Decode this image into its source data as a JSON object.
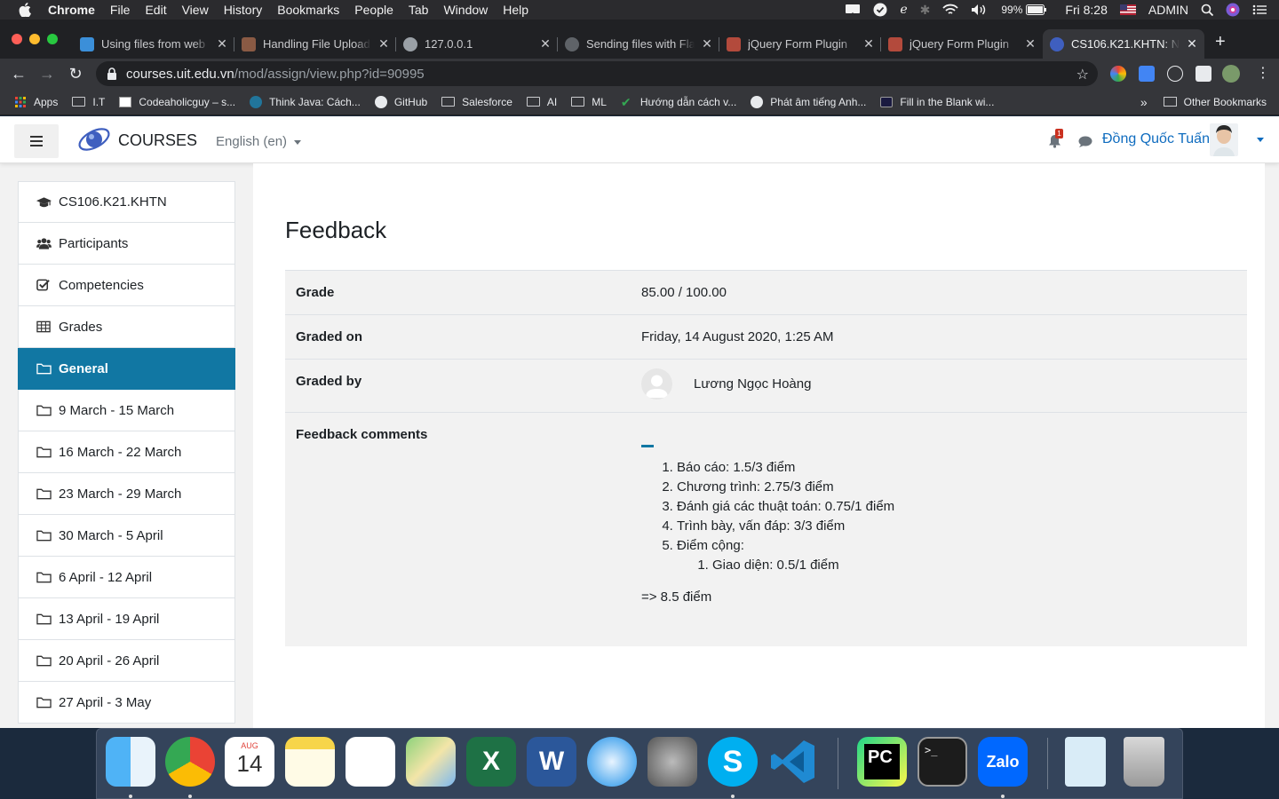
{
  "menubar": {
    "app": "Chrome",
    "items": [
      "File",
      "Edit",
      "View",
      "History",
      "Bookmarks",
      "People",
      "Tab",
      "Window",
      "Help"
    ],
    "battery": "99%",
    "clock": "Fri 8:28",
    "user": "ADMIN"
  },
  "tabs": [
    {
      "title": "Using files from web",
      "favicon_color": "#3b8fd9"
    },
    {
      "title": "Handling File Upload",
      "favicon_color": "#8a5a44"
    },
    {
      "title": "127.0.0.1",
      "favicon_color": "#9aa0a6"
    },
    {
      "title": "Sending files with Fla",
      "favicon_color": "#5f6368"
    },
    {
      "title": "jQuery Form Plugin",
      "favicon_color": "#b34a3c"
    },
    {
      "title": "jQuery Form Plugin",
      "favicon_color": "#b34a3c"
    },
    {
      "title": "CS106.K21.KHTN: N",
      "favicon_color": "#3f5fbf"
    }
  ],
  "toolbar": {
    "url_host": "courses.uit.edu.vn",
    "url_path": "/mod/assign/view.php?id=90995"
  },
  "bookmarks": {
    "items": [
      {
        "label": "Apps",
        "icon": "apps-grid-icon"
      },
      {
        "label": "I.T",
        "icon": "folder-icon"
      },
      {
        "label": "Codeaholicguy – s...",
        "icon": "site-icon"
      },
      {
        "label": "Think Java: Cách...",
        "icon": "wordpress-icon"
      },
      {
        "label": "GitHub",
        "icon": "github-icon"
      },
      {
        "label": "Salesforce",
        "icon": "folder-icon"
      },
      {
        "label": "AI",
        "icon": "folder-icon"
      },
      {
        "label": "ML",
        "icon": "folder-icon"
      },
      {
        "label": "Hướng dẫn cách v...",
        "icon": "check-icon"
      },
      {
        "label": "Phát âm tiếng Anh...",
        "icon": "globe-icon"
      },
      {
        "label": "Fill in the Blank wi...",
        "icon": "site-icon"
      }
    ],
    "overflow": "»",
    "other": "Other Bookmarks"
  },
  "navbar": {
    "brand": "COURSES",
    "language": "English (en)",
    "notification_count": "1",
    "user_name": "Đồng Quốc Tuấn"
  },
  "sidebar": {
    "items": [
      {
        "label": "CS106.K21.KHTN",
        "icon": "graduation-cap-icon",
        "active": false
      },
      {
        "label": "Participants",
        "icon": "users-icon",
        "active": false
      },
      {
        "label": "Competencies",
        "icon": "check-square-icon",
        "active": false
      },
      {
        "label": "Grades",
        "icon": "table-icon",
        "active": false
      },
      {
        "label": "General",
        "icon": "folder-icon",
        "active": true
      },
      {
        "label": "9 March - 15 March",
        "icon": "folder-icon",
        "active": false
      },
      {
        "label": "16 March - 22 March",
        "icon": "folder-icon",
        "active": false
      },
      {
        "label": "23 March - 29 March",
        "icon": "folder-icon",
        "active": false
      },
      {
        "label": "30 March - 5 April",
        "icon": "folder-icon",
        "active": false
      },
      {
        "label": "6 April - 12 April",
        "icon": "folder-icon",
        "active": false
      },
      {
        "label": "13 April - 19 April",
        "icon": "folder-icon",
        "active": false
      },
      {
        "label": "20 April - 26 April",
        "icon": "folder-icon",
        "active": false
      },
      {
        "label": "27 April - 3 May",
        "icon": "folder-icon",
        "active": false
      }
    ]
  },
  "feedback": {
    "heading": "Feedback",
    "grade_label": "Grade",
    "grade_value": "85.00 / 100.00",
    "graded_on_label": "Graded on",
    "graded_on_value": "Friday, 14 August 2020, 1:25 AM",
    "graded_by_label": "Graded by",
    "graded_by_value": "Lương Ngọc Hoàng",
    "comments_label": "Feedback comments",
    "comments": [
      "Báo cáo: 1.5/3 điểm",
      "Chương trình: 2.75/3 điểm",
      "Đánh giá các thuật toán: 0.75/1 điểm",
      "Trình bày, vấn đáp: 3/3 điểm",
      "Điểm cộng:"
    ],
    "sub_comments": [
      "Giao diện: 0.5/1 điểm"
    ],
    "result": "=> 8.5 điểm"
  },
  "dock": {
    "apps": [
      {
        "name": "finder-icon"
      },
      {
        "name": "chrome-icon"
      },
      {
        "name": "calendar-icon",
        "month": "AUG",
        "day": "14"
      },
      {
        "name": "notes-icon"
      },
      {
        "name": "reminders-icon"
      },
      {
        "name": "maps-icon"
      },
      {
        "name": "excel-icon"
      },
      {
        "name": "word-icon"
      },
      {
        "name": "safari-icon"
      },
      {
        "name": "system-preferences-icon"
      },
      {
        "name": "skype-icon"
      },
      {
        "name": "vscode-icon"
      },
      {
        "name": "pycharm-icon"
      },
      {
        "name": "terminal-icon"
      },
      {
        "name": "zalo-icon",
        "label": "Zalo"
      },
      {
        "name": "document-icon"
      },
      {
        "name": "trash-icon"
      }
    ]
  },
  "colors": {
    "accent": "#1177a3",
    "link": "#0f6cbf",
    "badge": "#ca3120"
  }
}
